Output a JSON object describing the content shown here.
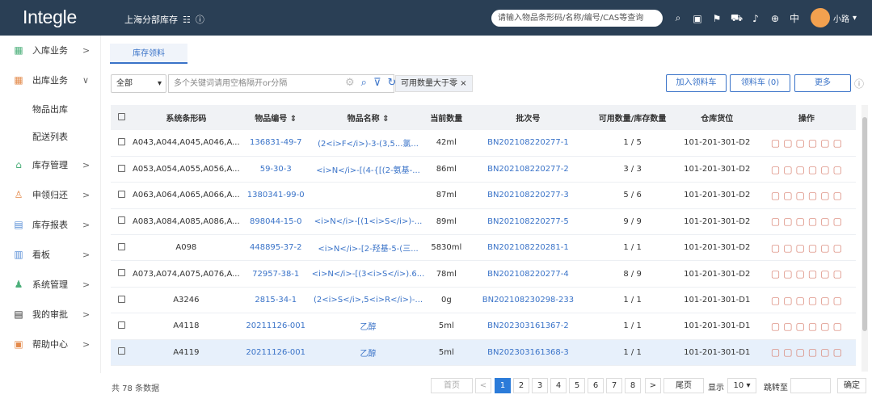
{
  "header": {
    "logo": "Integle",
    "company": "上海分部库存",
    "search_placeholder": "请输入物品条形码/名称/编号/CAS等查询",
    "lang": "中",
    "user": "小路"
  },
  "sidebar": {
    "items": [
      {
        "label": "入库业务"
      },
      {
        "label": "出库业务"
      },
      {
        "label": "库存管理"
      },
      {
        "label": "申领归还"
      },
      {
        "label": "库存报表"
      },
      {
        "label": "看板"
      },
      {
        "label": "系统管理"
      },
      {
        "label": "我的审批"
      },
      {
        "label": "帮助中心"
      }
    ],
    "subitems": [
      {
        "label": "物品出库"
      },
      {
        "label": "配送列表"
      }
    ]
  },
  "tab": {
    "label": "库存领料"
  },
  "filter": {
    "select": "全部",
    "keyword_placeholder": "多个关键词请用空格隔开or分隔",
    "chip": "可用数量大于零",
    "chip_close": "×"
  },
  "buttons": {
    "add": "加入领料车",
    "cart": "领料车 (0)",
    "more": "更多"
  },
  "table": {
    "headers": [
      "",
      "系统条形码",
      "物品编号 ⇕",
      "物品名称 ⇕",
      "当前数量",
      "批次号",
      "可用数量/库存数量",
      "仓库货位",
      "操作"
    ],
    "rows": [
      [
        "",
        "A043,A044,A045,A046,A...",
        "136831-49-7",
        "(2<i>F</i>)-3-(3,5...氯...",
        "42ml",
        "BN202108220277-1",
        "1 / 5",
        "101-201-301-D2"
      ],
      [
        "",
        "A053,A054,A055,A056,A...",
        "59-30-3",
        "<i>N</i>-[(4-{[(2-氨基-...",
        "86ml",
        "BN202108220277-2",
        "3 / 3",
        "101-201-301-D2"
      ],
      [
        "",
        "A063,A064,A065,A066,A...",
        "1380341-99-0",
        "",
        "87ml",
        "BN202108220277-3",
        "5 / 6",
        "101-201-301-D2"
      ],
      [
        "",
        "A083,A084,A085,A086,A...",
        "898044-15-0",
        "<i>N</i>-[(1<i>S</i>)-...",
        "89ml",
        "BN202108220277-5",
        "9 / 9",
        "101-201-301-D2"
      ],
      [
        "",
        "A098",
        "448895-37-2",
        "<i>N</i>-[2-羟基-5-(三...",
        "5830ml",
        "BN202108220281-1",
        "1 / 1",
        "101-201-301-D2"
      ],
      [
        "",
        "A073,A074,A075,A076,A...",
        "72957-38-1",
        "<i>N</i>-[(3<i>S</i>).6...",
        "78ml",
        "BN202108220277-4",
        "8 / 9",
        "101-201-301-D2"
      ],
      [
        "",
        "A3246",
        "2815-34-1",
        "(2<i>S</i>,5<i>R</i>)-...",
        "0g",
        "BN202108230298-233",
        "1 / 1",
        "101-201-301-D1"
      ],
      [
        "",
        "A4118",
        "20211126-001",
        "乙醇",
        "5ml",
        "BN202303161367-2",
        "1 / 1",
        "101-201-301-D1"
      ],
      [
        "",
        "A4119",
        "20211126-001",
        "乙醇",
        "5ml",
        "BN202303161368-3",
        "1 / 1",
        "101-201-301-D1"
      ]
    ]
  },
  "pager": {
    "total": "共 78 条数据",
    "first": "首页",
    "prev": "<",
    "pages": [
      "1",
      "2",
      "3",
      "4",
      "5",
      "6",
      "7",
      "8"
    ],
    "next": ">",
    "last": "尾页",
    "show": "显示",
    "size": "10",
    "goto": "跳转至",
    "confirm": "确定"
  }
}
